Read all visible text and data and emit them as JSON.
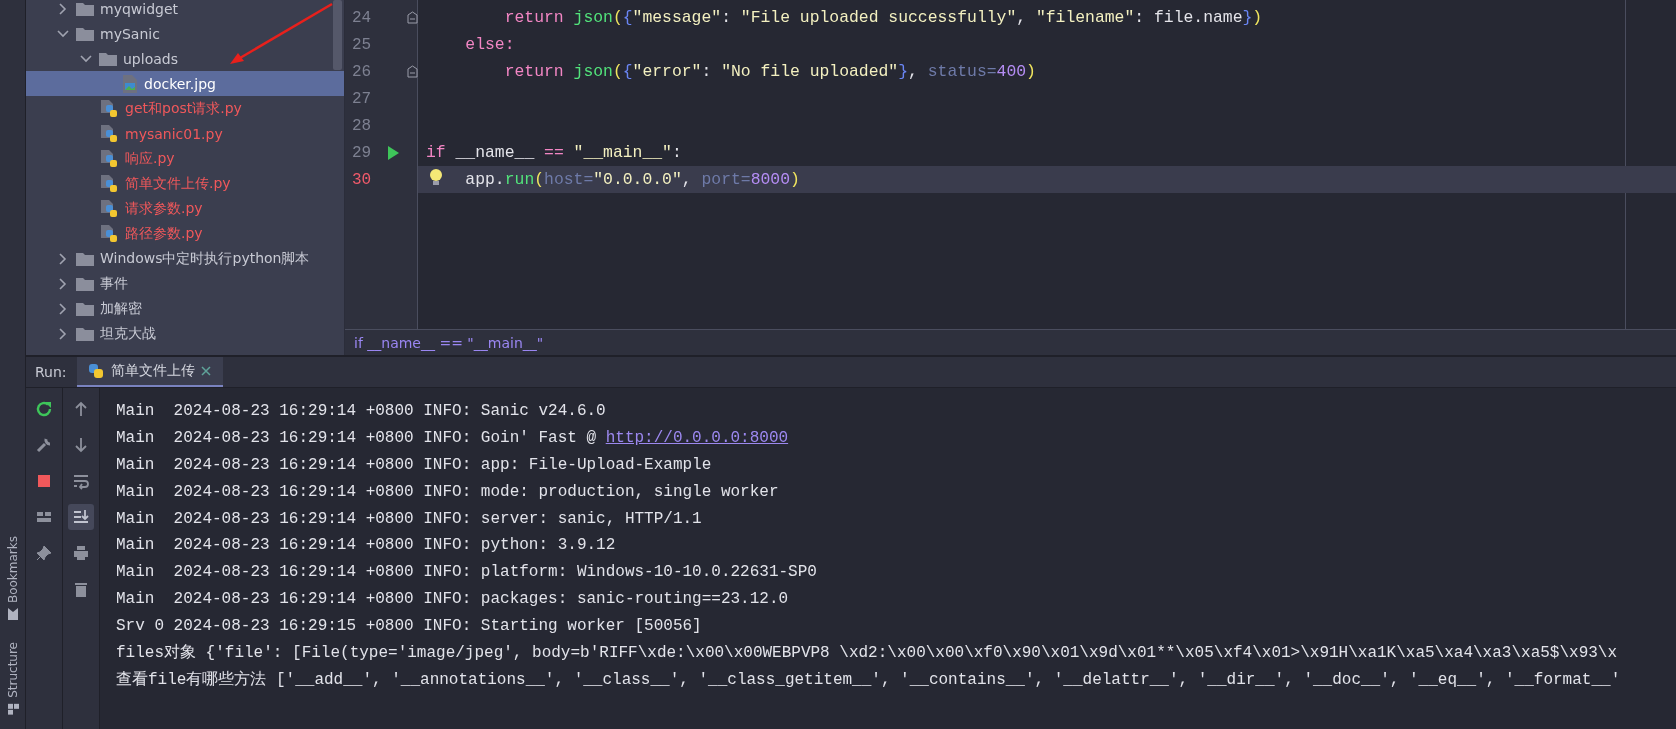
{
  "sidebar": {
    "labels": [
      {
        "text": "Bookmarks"
      },
      {
        "text": "Structure"
      }
    ]
  },
  "project_tree": {
    "items": [
      {
        "label": "myqwidget",
        "kind": "folder",
        "expanded": false,
        "selected": false,
        "untracked": false
      },
      {
        "label": "mySanic",
        "kind": "folder",
        "expanded": true,
        "selected": false,
        "untracked": false,
        "children": [
          {
            "label": "uploads",
            "kind": "folder",
            "expanded": true,
            "selected": false,
            "untracked": false,
            "children": [
              {
                "label": "docker.jpg",
                "kind": "image",
                "selected": true,
                "untracked": false
              }
            ]
          },
          {
            "label": "get和post请求.py",
            "kind": "python",
            "selected": false,
            "untracked": true
          },
          {
            "label": "mysanic01.py",
            "kind": "python",
            "selected": false,
            "untracked": true
          },
          {
            "label": "响应.py",
            "kind": "python",
            "selected": false,
            "untracked": true
          },
          {
            "label": "简单文件上传.py",
            "kind": "python",
            "selected": false,
            "untracked": true
          },
          {
            "label": "请求参数.py",
            "kind": "python",
            "selected": false,
            "untracked": true
          },
          {
            "label": "路径参数.py",
            "kind": "python",
            "selected": false,
            "untracked": true
          }
        ]
      },
      {
        "label": "Windows中定时执行python脚本",
        "kind": "folder",
        "expanded": false,
        "selected": false,
        "untracked": false
      },
      {
        "label": "事件",
        "kind": "folder",
        "expanded": false,
        "selected": false,
        "untracked": false
      },
      {
        "label": "加解密",
        "kind": "folder",
        "expanded": false,
        "selected": false,
        "untracked": false
      },
      {
        "label": "坦克大战",
        "kind": "folder",
        "expanded": false,
        "selected": false,
        "untracked": false
      }
    ]
  },
  "editor": {
    "lines": [
      {
        "number": "24",
        "fold": true,
        "run": false,
        "current": false,
        "bulb": false,
        "tokens": [
          {
            "kind": "keyword",
            "text": "        return"
          },
          {
            "kind": "function",
            "text": " json"
          },
          {
            "kind": "paren",
            "text": "("
          },
          {
            "kind": "brace",
            "text": "{"
          },
          {
            "kind": "string",
            "text": "\"message\""
          },
          {
            "kind": "plain",
            "text": ": "
          },
          {
            "kind": "string",
            "text": "\"File uploaded successfully\""
          },
          {
            "kind": "plain",
            "text": ", "
          },
          {
            "kind": "string",
            "text": "\"filename\""
          },
          {
            "kind": "plain",
            "text": ": file.name"
          },
          {
            "kind": "brace",
            "text": "}"
          },
          {
            "kind": "paren",
            "text": ")"
          }
        ]
      },
      {
        "number": "25",
        "fold": false,
        "run": false,
        "current": false,
        "bulb": false,
        "tokens": [
          {
            "kind": "keyword",
            "text": "    else:"
          }
        ]
      },
      {
        "number": "26",
        "fold": true,
        "run": false,
        "current": false,
        "bulb": false,
        "tokens": [
          {
            "kind": "keyword",
            "text": "        return"
          },
          {
            "kind": "function",
            "text": " json"
          },
          {
            "kind": "paren",
            "text": "("
          },
          {
            "kind": "brace",
            "text": "{"
          },
          {
            "kind": "string",
            "text": "\"error\""
          },
          {
            "kind": "plain",
            "text": ": "
          },
          {
            "kind": "string",
            "text": "\"No file uploaded\""
          },
          {
            "kind": "brace",
            "text": "}"
          },
          {
            "kind": "plain",
            "text": ", "
          },
          {
            "kind": "param",
            "text": "status="
          },
          {
            "kind": "number",
            "text": "400"
          },
          {
            "kind": "paren",
            "text": ")"
          }
        ]
      },
      {
        "number": "27",
        "fold": false,
        "run": false,
        "current": false,
        "bulb": false
      },
      {
        "number": "28",
        "fold": false,
        "run": false,
        "current": false,
        "bulb": false
      },
      {
        "number": "29",
        "fold": false,
        "run": true,
        "current": false,
        "bulb": false,
        "tokens": [
          {
            "kind": "keyword",
            "text": "if"
          },
          {
            "kind": "plain",
            "text": " __name__ "
          },
          {
            "kind": "keyword",
            "text": "=="
          },
          {
            "kind": "string",
            "text": " \"__main__\""
          },
          {
            "kind": "plain",
            "text": ":"
          }
        ]
      },
      {
        "number": "30",
        "fold": false,
        "run": false,
        "current": true,
        "bulb": true,
        "tokens": [
          {
            "kind": "plain",
            "text": "    app."
          },
          {
            "kind": "function",
            "text": "run"
          },
          {
            "kind": "paren",
            "text": "("
          },
          {
            "kind": "param",
            "text": "host="
          },
          {
            "kind": "string",
            "text": "\"0.0.0.0\""
          },
          {
            "kind": "plain",
            "text": ", "
          },
          {
            "kind": "param",
            "text": "port="
          },
          {
            "kind": "number",
            "text": "8000"
          },
          {
            "kind": "paren",
            "text": ")"
          }
        ]
      }
    ],
    "breadcrumb": "if __name__ == \"__main__\""
  },
  "run": {
    "label": "Run:",
    "tabs": [
      {
        "label": "简单文件上传",
        "selected": true
      }
    ],
    "toggles": [
      {
        "selected": false
      },
      {
        "selected": false
      },
      {
        "selected": false
      },
      {
        "selected": true
      },
      {
        "selected": false
      },
      {
        "selected": false
      }
    ],
    "console": [
      {
        "text": "Main  2024-08-23 16:29:14 +0800 INFO: Sanic v24.6.0"
      },
      {
        "text": "Main  2024-08-23 16:29:14 +0800 INFO: Goin' Fast @ ",
        "link": "http://0.0.0.0:8000"
      },
      {
        "text": "Main  2024-08-23 16:29:14 +0800 INFO: app: File-Upload-Example"
      },
      {
        "text": "Main  2024-08-23 16:29:14 +0800 INFO: mode: production, single worker"
      },
      {
        "text": "Main  2024-08-23 16:29:14 +0800 INFO: server: sanic, HTTP/1.1"
      },
      {
        "text": "Main  2024-08-23 16:29:14 +0800 INFO: python: 3.9.12"
      },
      {
        "text": "Main  2024-08-23 16:29:14 +0800 INFO: platform: Windows-10-10.0.22631-SP0"
      },
      {
        "text": "Main  2024-08-23 16:29:14 +0800 INFO: packages: sanic-routing==23.12.0"
      },
      {
        "text": "Srv 0 2024-08-23 16:29:15 +0800 INFO: Starting worker [50056]"
      },
      {
        "text": "files对象 {'file': [File(type='image/jpeg', body=b'RIFF\\xde:\\x00\\x00WEBPVP8 \\xd2:\\x00\\x00\\xf0\\x90\\x01\\x9d\\x01**\\x05\\xf4\\x01>\\x91H\\xa1K\\xa5\\xa4\\xa3\\xa5$\\x93\\x"
      },
      {
        "text": "查看file有哪些方法 ['__add__', '__annotations__', '__class__', '__class_getitem__', '__contains__', '__delattr__', '__dir__', '__doc__', '__eq__', '__format__'"
      }
    ]
  }
}
